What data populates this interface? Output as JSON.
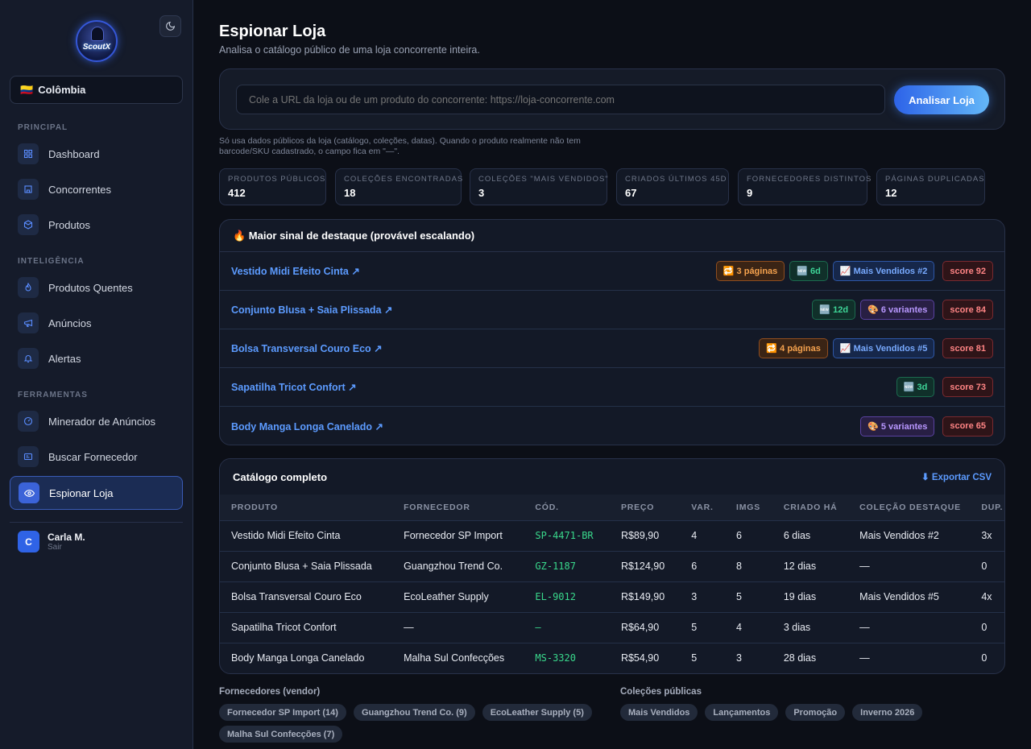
{
  "brand": {
    "logo_text": "ScoutX"
  },
  "country": {
    "flag": "🇨🇴",
    "label": "Colômbia"
  },
  "sidebar": {
    "sections": [
      "PRINCIPAL",
      "INTELIGÊNCIA",
      "FERRAMENTAS"
    ],
    "items": [
      {
        "label": "Dashboard",
        "icon": "grid-icon"
      },
      {
        "label": "Concorrentes",
        "icon": "store-icon"
      },
      {
        "label": "Produtos",
        "icon": "box-icon"
      },
      {
        "label": "Produtos Quentes",
        "icon": "flame-icon"
      },
      {
        "label": "Anúncios",
        "icon": "megaphone-icon"
      },
      {
        "label": "Alertas",
        "icon": "bell-icon"
      },
      {
        "label": "Minerador de Anúncios",
        "icon": "gauge-icon"
      },
      {
        "label": "Buscar Fornecedor",
        "icon": "id-card-icon"
      },
      {
        "label": "Espionar Loja",
        "icon": "eye-icon"
      }
    ]
  },
  "user": {
    "initial": "C",
    "name": "Carla M.",
    "logout": "Sair"
  },
  "page": {
    "title": "Espionar Loja",
    "subtitle": "Analisa o catálogo público de uma loja concorrente inteira."
  },
  "search": {
    "placeholder": "Cole a URL da loja ou de um produto do concorrente: https://loja-concorrente.com",
    "button": "Analisar Loja"
  },
  "note": "Só usa dados públicos da loja (catálogo, coleções, datas). Quando o produto realmente não tem barcode/SKU cadastrado, o campo fica em \"—\".",
  "stats": [
    {
      "label": "PRODUTOS PÚBLICOS",
      "value": "412"
    },
    {
      "label": "COLEÇÕES ENCONTRADAS",
      "value": "18"
    },
    {
      "label": "COLEÇÕES \"MAIS VENDIDOS\"",
      "value": "3"
    },
    {
      "label": "CRIADOS ÚLTIMOS 45D",
      "value": "67"
    },
    {
      "label": "FORNECEDORES DISTINTOS",
      "value": "9"
    },
    {
      "label": "PÁGINAS DUPLICADAS",
      "value": "12"
    }
  ],
  "hot": {
    "title": "🔥 Maior sinal de destaque (provável escalando)",
    "rows": [
      {
        "name": "Vestido Midi Efeito Cinta ↗",
        "badges": [
          {
            "t": "🔁 3 páginas",
            "c": "or"
          },
          {
            "t": "🆕 6d",
            "c": "gr"
          },
          {
            "t": "📈 Mais Vendidos #2",
            "c": "bl"
          }
        ],
        "score": "score 92"
      },
      {
        "name": "Conjunto Blusa + Saia Plissada ↗",
        "badges": [
          {
            "t": "🆕 12d",
            "c": "gr"
          },
          {
            "t": "🎨 6 variantes",
            "c": "pu"
          }
        ],
        "score": "score 84"
      },
      {
        "name": "Bolsa Transversal Couro Eco ↗",
        "badges": [
          {
            "t": "🔁 4 páginas",
            "c": "or"
          },
          {
            "t": "📈 Mais Vendidos #5",
            "c": "bl"
          }
        ],
        "score": "score 81"
      },
      {
        "name": "Sapatilha Tricot Confort ↗",
        "badges": [
          {
            "t": "🆕 3d",
            "c": "gr"
          }
        ],
        "score": "score 73"
      },
      {
        "name": "Body Manga Longa Canelado ↗",
        "badges": [
          {
            "t": "🎨 5 variantes",
            "c": "pu"
          }
        ],
        "score": "score 65"
      }
    ]
  },
  "catalog": {
    "title": "Catálogo completo",
    "export": "⬇ Exportar CSV",
    "columns": [
      "PRODUTO",
      "FORNECEDOR",
      "CÓD.",
      "PREÇO",
      "VAR.",
      "IMGS",
      "CRIADO HÁ",
      "COLEÇÃO DESTAQUE",
      "DUP."
    ],
    "rows": [
      [
        "Vestido Midi Efeito Cinta",
        "Fornecedor SP Import",
        "SP-4471-BR",
        "R$89,90",
        "4",
        "6",
        "6 dias",
        "Mais Vendidos #2",
        "3x"
      ],
      [
        "Conjunto Blusa + Saia Plissada",
        "Guangzhou Trend Co.",
        "GZ-1187",
        "R$124,90",
        "6",
        "8",
        "12 dias",
        "—",
        "0"
      ],
      [
        "Bolsa Transversal Couro Eco",
        "EcoLeather Supply",
        "EL-9012",
        "R$149,90",
        "3",
        "5",
        "19 dias",
        "Mais Vendidos #5",
        "4x"
      ],
      [
        "Sapatilha Tricot Confort",
        "—",
        "—",
        "R$64,90",
        "5",
        "4",
        "3 dias",
        "—",
        "0"
      ],
      [
        "Body Manga Longa Canelado",
        "Malha Sul Confecções",
        "MS-3320",
        "R$54,90",
        "5",
        "3",
        "28 dias",
        "—",
        "0"
      ]
    ]
  },
  "vendors": {
    "title": "Fornecedores (vendor)",
    "items": [
      "Fornecedor SP Import (14)",
      "Guangzhou Trend Co. (9)",
      "EcoLeather Supply (5)",
      "Malha Sul Confecções (7)"
    ]
  },
  "collections": {
    "title": "Coleções públicas",
    "items": [
      "Mais Vendidos",
      "Lançamentos",
      "Promoção",
      "Inverno 2026"
    ]
  }
}
